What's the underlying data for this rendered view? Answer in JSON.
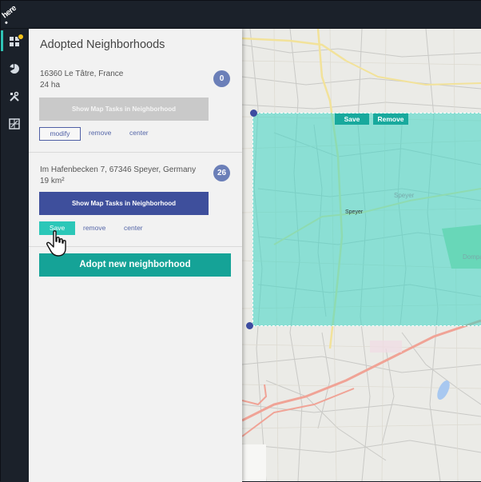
{
  "app": {
    "logo_text": "here"
  },
  "rail": {
    "icons": [
      "dashboard-icon",
      "pie-chart-icon",
      "tools-icon",
      "map-tiles-icon"
    ],
    "notification_color": "#f3c21a"
  },
  "panel": {
    "title": "Adopted Neighborhoods",
    "neighborhoods": [
      {
        "address": "16360 Le Tâtre, France",
        "size": "24 ha",
        "count": "0",
        "task_button": "Show Map Tasks in Neighborhood",
        "action_primary": "modify",
        "action_remove": "remove",
        "action_center": "center"
      },
      {
        "address": "Im Hafenbecken 7, 67346 Speyer, Germany",
        "size": "19 km²",
        "count": "26",
        "task_button": "Show Map Tasks in Neighborhood",
        "action_primary": "Save",
        "action_remove": "remove",
        "action_center": "center"
      }
    ],
    "adopt_button": "Adopt new neighborhood"
  },
  "map": {
    "save_label": "Save",
    "remove_label": "Remove",
    "labels": [
      "Speyer",
      "Speyer",
      "Dompa"
    ],
    "colors": {
      "selection": "#3cd6c4",
      "accent": "#15a397",
      "handle": "#3c4ca0"
    }
  }
}
